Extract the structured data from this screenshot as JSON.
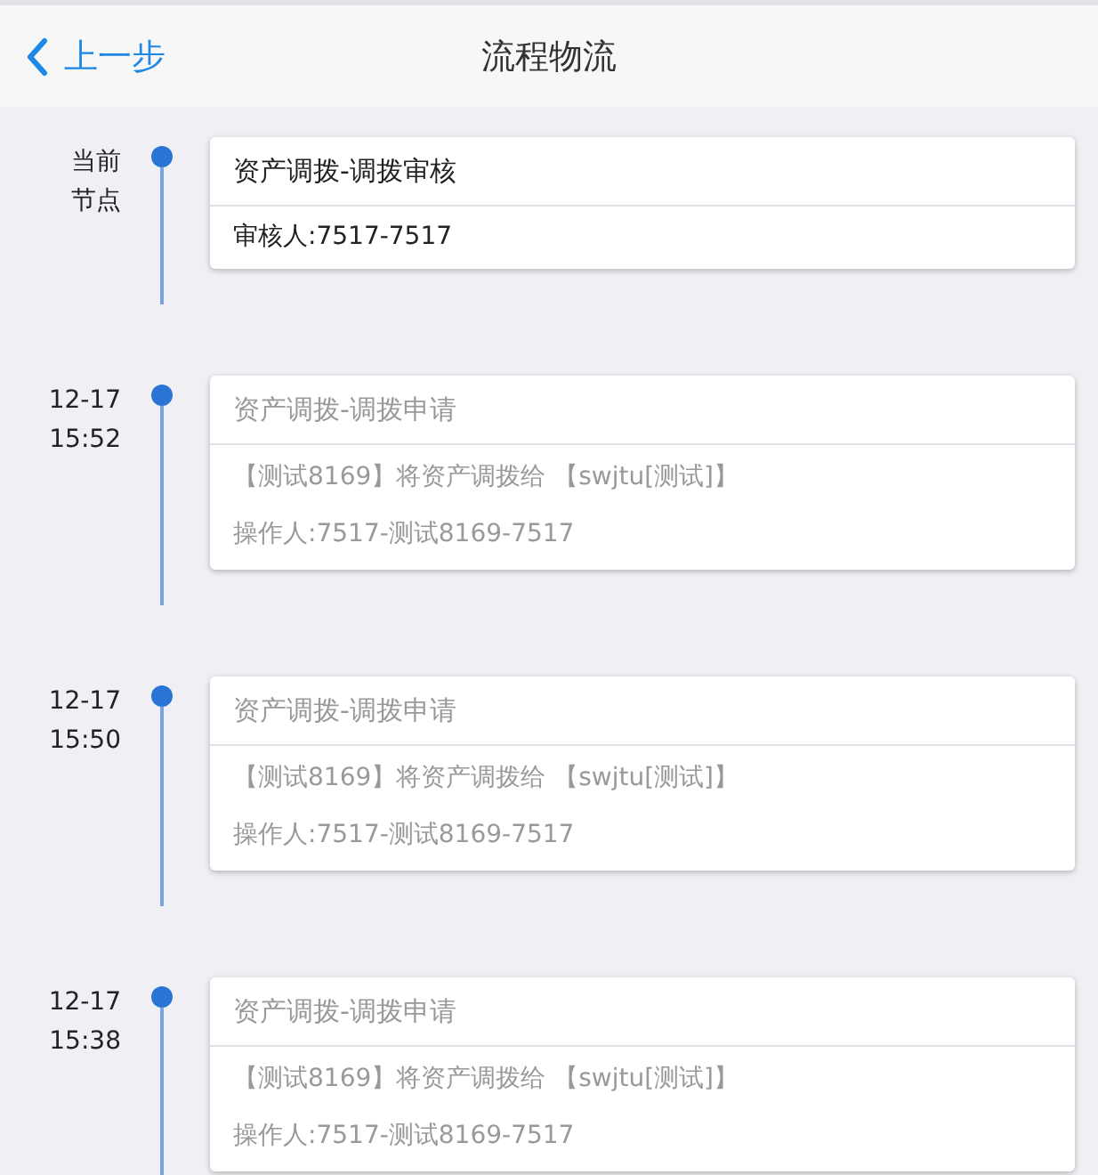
{
  "header": {
    "back_label": "上一步",
    "title": "流程物流"
  },
  "timeline": [
    {
      "time": [
        "当前",
        "节点"
      ],
      "current": true,
      "title": "资产调拨-调拨审核",
      "lines": [
        "审核人:7517-7517"
      ]
    },
    {
      "time": [
        "12-17",
        "15:52"
      ],
      "current": false,
      "title": "资产调拨-调拨申请",
      "lines": [
        "【测试8169】将资产调拨给 【swjtu[测试]】",
        "操作人:7517-测试8169-7517"
      ]
    },
    {
      "time": [
        "12-17",
        "15:50"
      ],
      "current": false,
      "title": "资产调拨-调拨申请",
      "lines": [
        "【测试8169】将资产调拨给 【swjtu[测试]】",
        "操作人:7517-测试8169-7517"
      ]
    },
    {
      "time": [
        "12-17",
        "15:38"
      ],
      "current": false,
      "title": "资产调拨-调拨申请",
      "lines": [
        "【测试8169】将资产调拨给 【swjtu[测试]】",
        "操作人:7517-测试8169-7517"
      ]
    }
  ]
}
